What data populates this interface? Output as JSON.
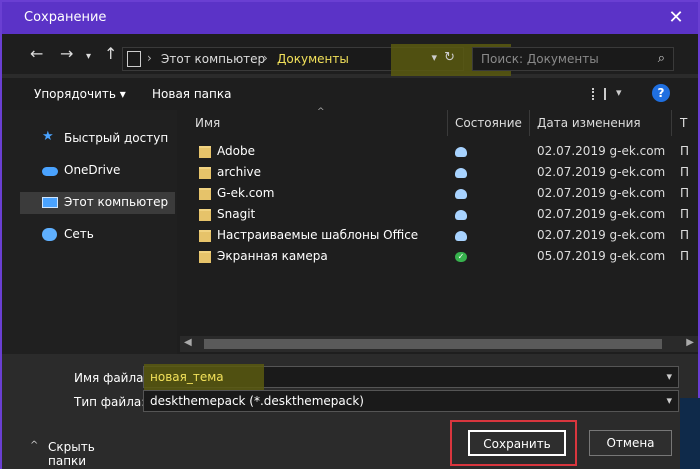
{
  "window": {
    "title": "Сохранение"
  },
  "addressbar": {
    "crumbs": [
      "Этот компьютер",
      "Документы"
    ]
  },
  "search": {
    "placeholder": "Поиск: Документы"
  },
  "toolbar": {
    "organize_label": "Упорядочить",
    "new_folder_label": "Новая папка",
    "help_label": "?"
  },
  "nav_items": [
    {
      "label": "Быстрый доступ",
      "icon": "star-icon"
    },
    {
      "label": "OneDrive",
      "icon": "cloud-icon"
    },
    {
      "label": "Этот компьютер",
      "icon": "computer-icon"
    },
    {
      "label": "Сеть",
      "icon": "network-icon"
    }
  ],
  "columns": {
    "name": "Имя",
    "status": "Состояние",
    "date": "Дата изменения",
    "extra": "Т"
  },
  "files": [
    {
      "name": "Adobe",
      "status": "cloud",
      "date": "02.07.2019 g-ek.com",
      "extra": "П"
    },
    {
      "name": "archive",
      "status": "cloud",
      "date": "02.07.2019 g-ek.com",
      "extra": "П"
    },
    {
      "name": "G-ek.com",
      "status": "cloud",
      "date": "02.07.2019 g-ek.com",
      "extra": "П"
    },
    {
      "name": "Snagit",
      "status": "cloud",
      "date": "02.07.2019 g-ek.com",
      "extra": "П"
    },
    {
      "name": "Настраиваемые шаблоны Office",
      "status": "cloud",
      "date": "02.07.2019 g-ek.com",
      "extra": "П"
    },
    {
      "name": "Экранная камера",
      "status": "ok",
      "date": "05.07.2019 g-ek.com",
      "extra": "П"
    }
  ],
  "fields": {
    "filename_label": "Имя файла:",
    "filename_value": "новая_тема",
    "filetype_label": "Тип файла:",
    "filetype_value": "deskthemepack (*.deskthemepack)"
  },
  "footer": {
    "hide_folders_label": "Скрыть папки",
    "save_label": "Сохранить",
    "cancel_label": "Отмена"
  },
  "colors": {
    "titlebar": "#5b33c7",
    "highlight": "#5a5a10",
    "highlight_text": "#f2e15a",
    "red_box": "#d9363e"
  }
}
